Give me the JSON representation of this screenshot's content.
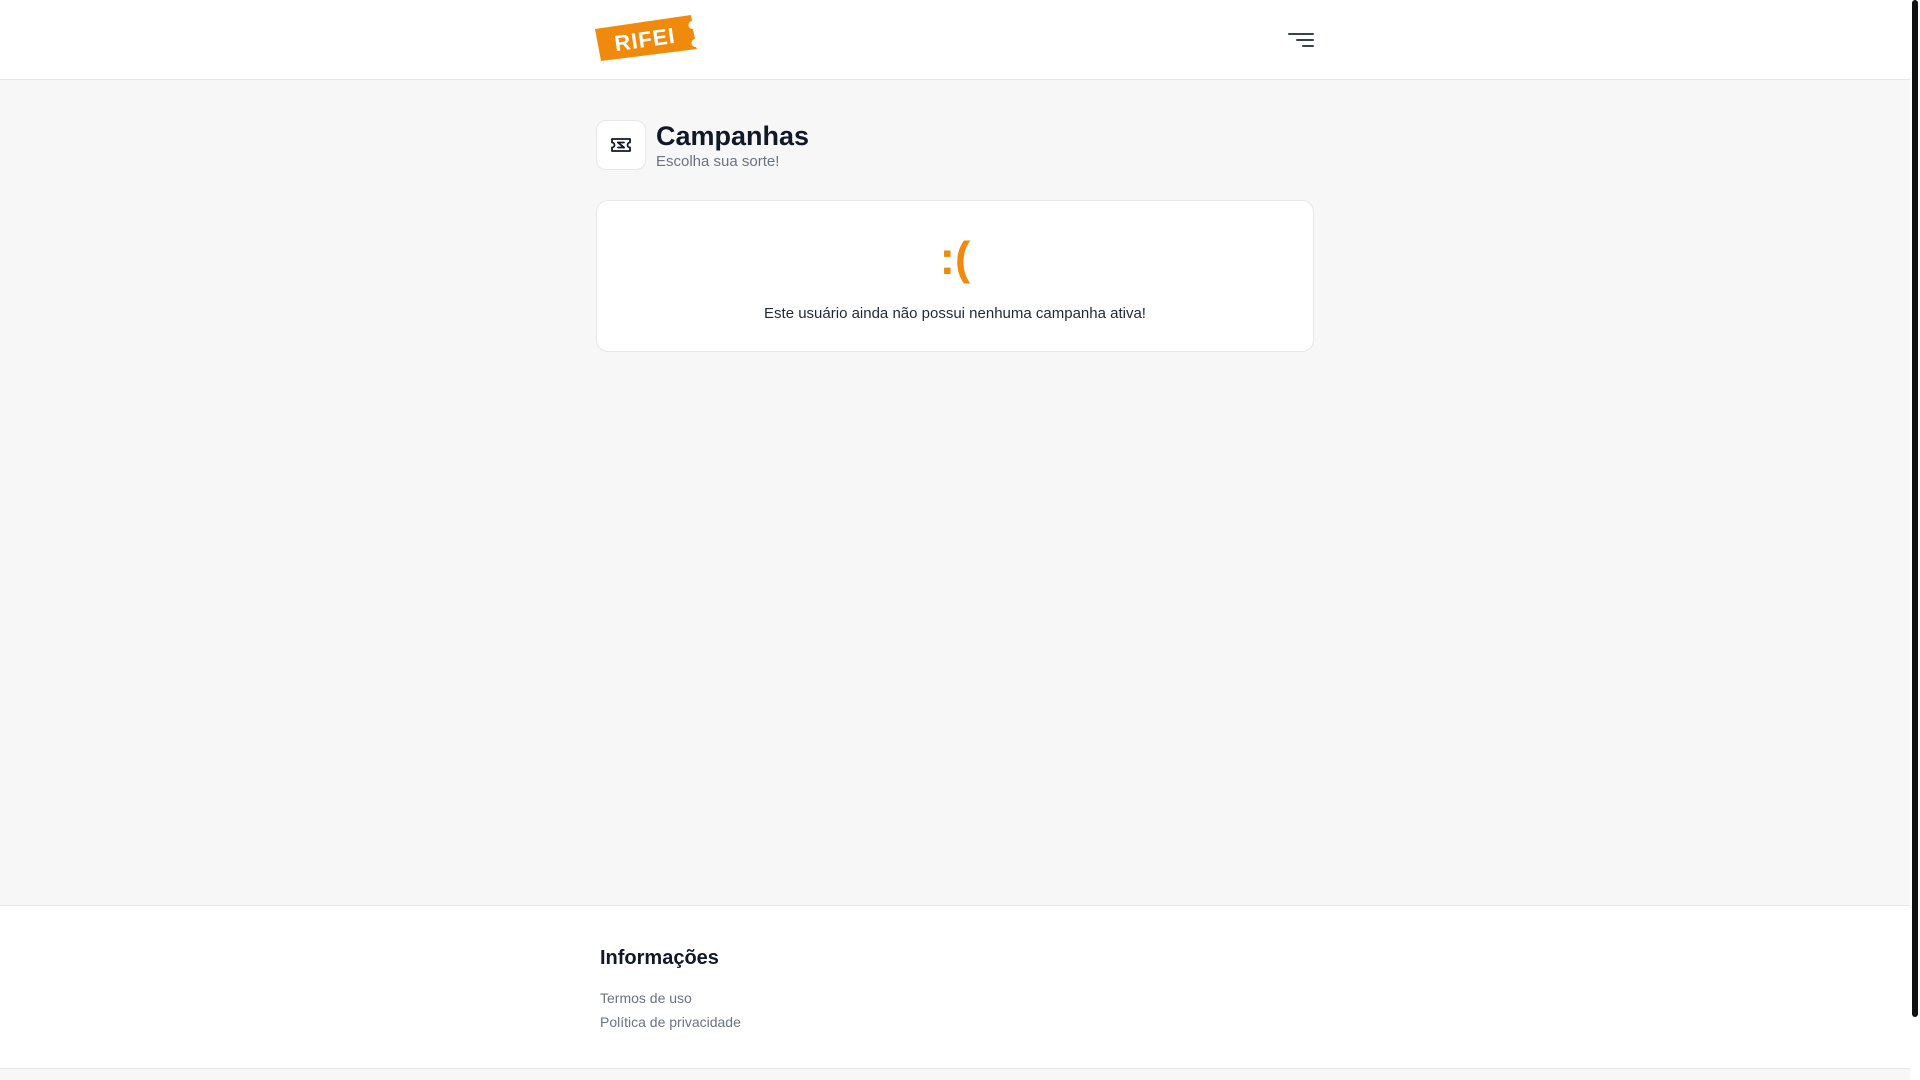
{
  "brand": {
    "logo_text": "RIFEI",
    "accent_color": "#f08a0c"
  },
  "header": {
    "menu_icon": "hamburger-menu-icon"
  },
  "campaigns": {
    "icon": "ticket-icon",
    "title": "Campanhas",
    "subtitle": "Escolha sua sorte!"
  },
  "empty_state": {
    "face": ":(",
    "message": "Este usuário ainda não possui nenhuma campanha ativa!"
  },
  "footer": {
    "title": "Informações",
    "links": [
      {
        "label": "Termos de uso"
      },
      {
        "label": "Política de privacidade"
      }
    ]
  }
}
